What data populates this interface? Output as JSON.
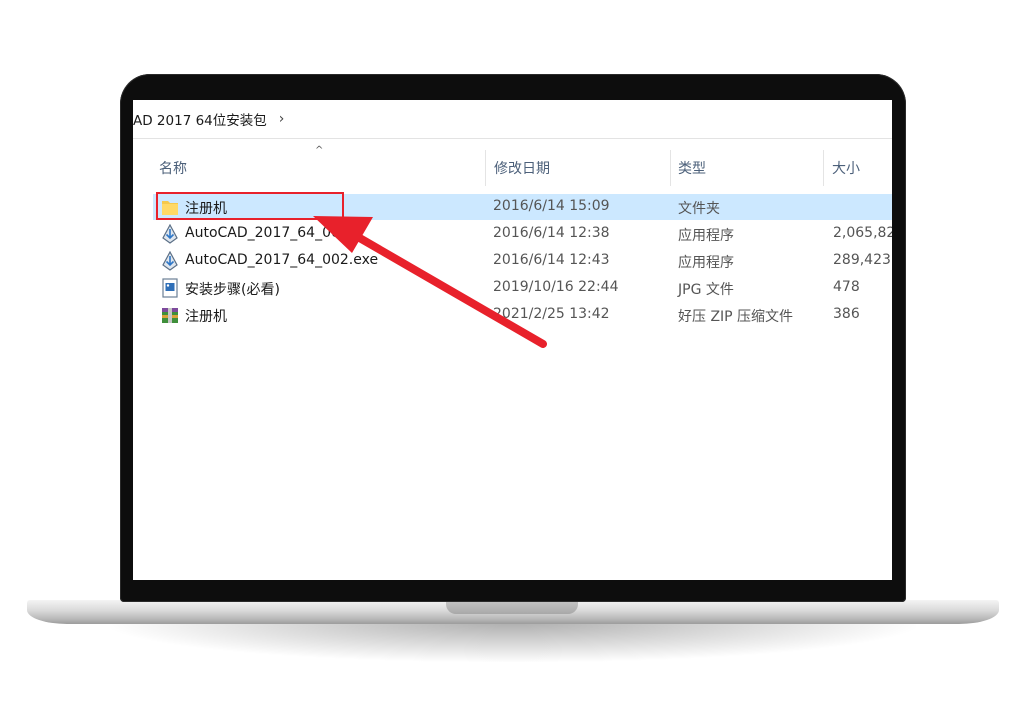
{
  "breadcrumb": {
    "path": "AD 2017 64位安装包",
    "chevron": "›"
  },
  "columns": {
    "name": "名称",
    "date": "修改日期",
    "type": "类型",
    "size": "大小",
    "sort_indicator": "^"
  },
  "files": [
    {
      "name": "注册机",
      "date": "2016/6/14 15:09",
      "type": "文件夹",
      "size": "",
      "icon": "folder-icon",
      "selected": true
    },
    {
      "name": "AutoCAD_2017_64_001",
      "date": "2016/6/14 12:38",
      "type": "应用程序",
      "size": "2,065,82",
      "icon": "autocad-installer-icon",
      "selected": false
    },
    {
      "name": "AutoCAD_2017_64_002.exe",
      "date": "2016/6/14 12:43",
      "type": "应用程序",
      "size": "289,423",
      "icon": "autocad-installer-icon",
      "selected": false
    },
    {
      "name": "安装步骤(必看)",
      "date": "2019/10/16 22:44",
      "type": "JPG 文件",
      "size": "478",
      "icon": "image-file-icon",
      "selected": false
    },
    {
      "name": "注册机",
      "date": "2021/2/25 13:42",
      "type": "好压 ZIP 压缩文件",
      "size": "386",
      "icon": "zip-archive-icon",
      "selected": false
    }
  ],
  "colors": {
    "selection": "#cce8ff",
    "annotation": "#e8212b",
    "header_text": "#4c607a"
  }
}
